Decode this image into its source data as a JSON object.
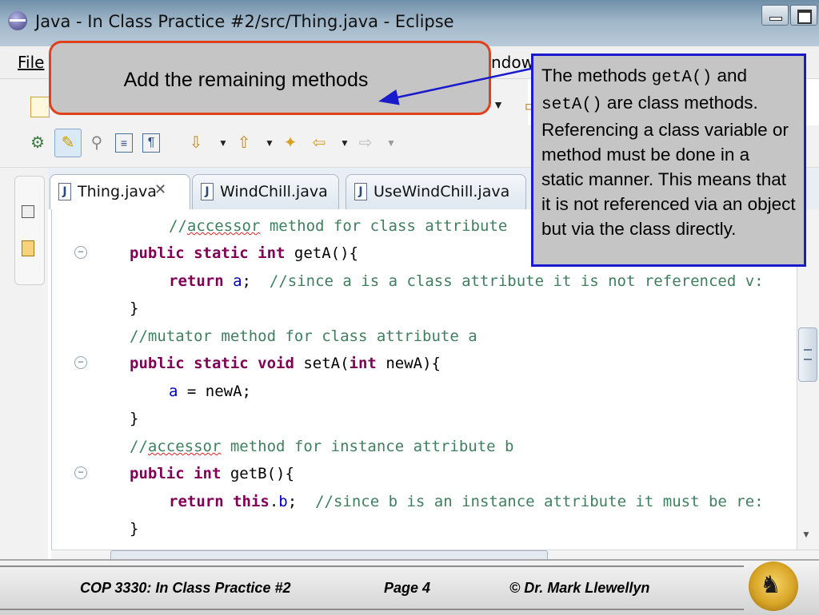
{
  "window": {
    "title": "Java - In Class Practice #2/src/Thing.java - Eclipse"
  },
  "menu": {
    "file": "File",
    "window": "ndow"
  },
  "tabs": [
    {
      "label": "Thing.java",
      "close": "✕"
    },
    {
      "label": "WindChill.java"
    },
    {
      "label": "UseWindChill.java"
    }
  ],
  "code": {
    "line1_comment": "//",
    "line1_word": "accessor",
    "line1_rest": " method for class attribute",
    "line2_kw": "public static int",
    "line2_rest": " getA(){",
    "line3_kw": "return",
    "line3_field": "a",
    "line3_semi": ";  ",
    "line3_comment": "//since a is a class attribute it is not referenced v:",
    "line4": "}",
    "line5_comment": "//mutator method for class attribute a",
    "line6_kw": "public static void",
    "line6_mid": " setA(",
    "line6_kw2": "int",
    "line6_rest": " newA){",
    "line7_field": "a",
    "line7_rest": " = newA;",
    "line8": "}",
    "line9_comment": "//",
    "line9_word": "accessor",
    "line9_rest": " method for instance attribute b",
    "line10_kw": "public int",
    "line10_rest": " getB(){",
    "line11_kw": "return this",
    "line11_dot": ".",
    "line11_field": "b",
    "line11_semi": ";  ",
    "line11_comment": "//since b is an instance attribute it must be re:",
    "line12": "}"
  },
  "callouts": {
    "top": "Add the remaining methods",
    "right_1": "The methods ",
    "right_code1": "getA()",
    "right_2": "  and ",
    "right_code2": "setA()",
    "right_3": " are class methods. Referencing a class variable or method must be done in a static manner. This means that it is not referenced via an object but via the class directly."
  },
  "footer": {
    "course": "COP 3330:  In Class Practice #2",
    "page": "Page 4",
    "author": "© Dr. Mark Llewellyn"
  },
  "colors": {
    "keyword": "#7f0055",
    "comment": "#3f7f5f",
    "field": "#0000c0",
    "callout_border_top": "#e0401a",
    "callout_border_right": "#1a1acd",
    "arrow": "#1a1acd"
  }
}
